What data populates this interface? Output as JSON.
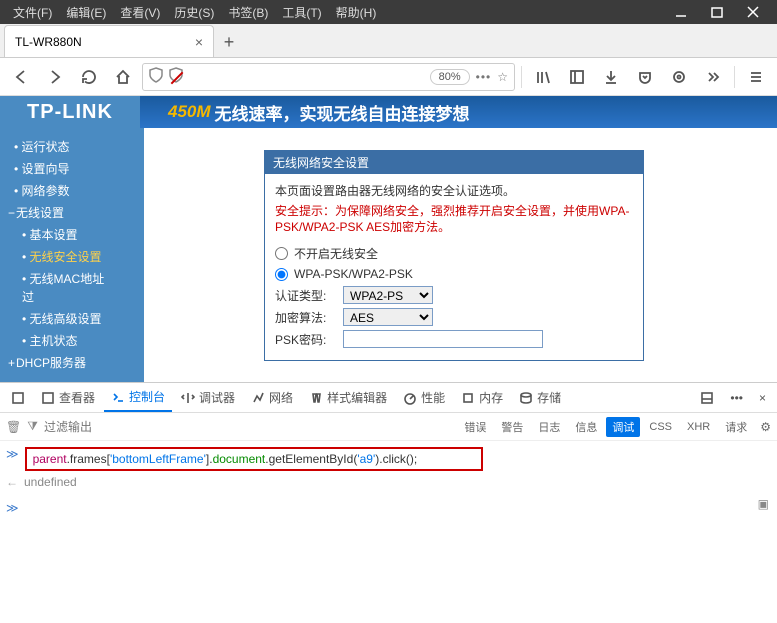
{
  "menubar": {
    "items": [
      "文件(F)",
      "编辑(E)",
      "查看(V)",
      "历史(S)",
      "书签(B)",
      "工具(T)",
      "帮助(H)"
    ]
  },
  "tab": {
    "title": "TL-WR880N"
  },
  "toolbar": {
    "zoom": "80%"
  },
  "banner": {
    "logo": "TP-LINK",
    "slogan_highlight": "450M",
    "slogan_rest": "无线速率，实现无线自由连接梦想"
  },
  "sidebar": {
    "items": [
      {
        "label": "运行状态",
        "type": "leaf"
      },
      {
        "label": "设置向导",
        "type": "leaf"
      },
      {
        "label": "网络参数",
        "type": "leaf"
      },
      {
        "label": "无线设置",
        "type": "parent",
        "expanded": true
      },
      {
        "label": "基本设置",
        "type": "child"
      },
      {
        "label": "无线安全设置",
        "type": "child",
        "active": true
      },
      {
        "label": "无线MAC地址过",
        "type": "child"
      },
      {
        "label": "无线高级设置",
        "type": "child"
      },
      {
        "label": "主机状态",
        "type": "child"
      },
      {
        "label": "DHCP服务器",
        "type": "parent",
        "expanded": false
      }
    ]
  },
  "panel": {
    "title": "无线网络安全设置",
    "note": "本页面设置路由器无线网络的安全认证选项。",
    "warn": "安全提示：为保障网络安全，强烈推荐开启安全设置，并使用WPA-PSK/WPA2-PSK AES加密方法。",
    "radio_off": "不开启无线安全",
    "radio_wpa": "WPA-PSK/WPA2-PSK",
    "field_auth": "认证类型:",
    "auth_value": "WPA2-PS",
    "field_enc": "加密算法:",
    "enc_value": "AES",
    "field_psk": "PSK密码:",
    "psk_value": ""
  },
  "devtools": {
    "tabs": {
      "inspector": "查看器",
      "console": "控制台",
      "debugger": "调试器",
      "network": "网络",
      "style": "样式编辑器",
      "perf": "性能",
      "memory": "内存",
      "storage": "存储"
    },
    "filter_placeholder": "过滤输出",
    "chips": [
      "错误",
      "警告",
      "日志",
      "信息",
      "调试",
      "CSS",
      "XHR",
      "请求"
    ],
    "chip_active": "调试",
    "cmd": {
      "p1": "parent",
      "p2": ".frames[",
      "p3": "'bottomLeftFrame'",
      "p4": "].",
      "p5": "document",
      "p6": ".getElementById(",
      "p7": "'a9'",
      "p8": ").click();"
    },
    "result": "undefined"
  }
}
